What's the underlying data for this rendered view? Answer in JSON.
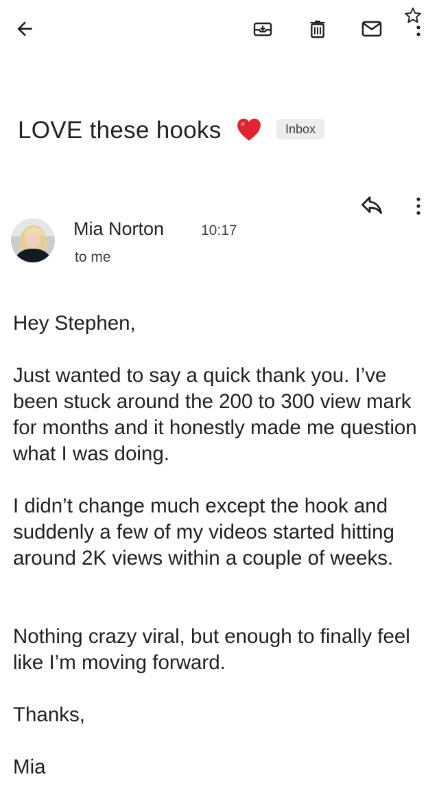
{
  "toolbar": {
    "back_icon": "arrow-left-icon",
    "archive_icon": "archive-icon",
    "delete_icon": "trash-icon",
    "mark_unread_icon": "mail-icon",
    "star_icon": "star-outline-icon",
    "more_icon": "more-vert-icon"
  },
  "message": {
    "subject": "LOVE these hooks",
    "subject_emoji": "heart-emoji",
    "label": "Inbox",
    "sender_name": "Mia Norton",
    "time": "10:17",
    "recipient": "to me",
    "reply_icon": "reply-icon",
    "more_icon": "more-vert-icon",
    "body": {
      "greeting": "Hey Stephen,",
      "paragraph_1": "Just wanted to say a quick thank you. I’ve been stuck around the 200 to 300 view mark for months and it honestly made me question what I was doing.",
      "paragraph_2": "I didn’t change much except the hook and suddenly a few of my videos started hitting around 2K views within a couple of weeks.",
      "paragraph_3": "Nothing crazy viral, but enough to finally feel like I’m moving forward.",
      "signoff": "Thanks,",
      "signature": "Mia"
    }
  },
  "colors": {
    "text": "#1f1f1f",
    "secondary_text": "#3c4043",
    "badge_bg": "#ededed",
    "heart": "#e0242f"
  }
}
